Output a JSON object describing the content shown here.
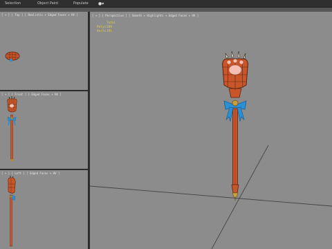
{
  "menubar": {
    "items": [
      "Selection",
      "Object Paint",
      "Populate"
    ],
    "icon": "dropdown-icon"
  },
  "viewports": {
    "top": {
      "label": "[ + ] [ Top ] [ Realistic + Edged Faces + HV ]"
    },
    "front": {
      "label": "[ + ] [ Front ] [ Edged Faces + HV ]"
    },
    "left": {
      "label": "[ + ] [ Left ] [ Edged Faces + HV ]"
    },
    "perspective": {
      "label": "[ + ] [ Perspective ] [ Smooth + Highlights + Edged Faces + HV ]",
      "stats": [
        {
          "label": "",
          "value": "Total"
        },
        {
          "label": "Polys",
          "value": "209"
        },
        {
          "label": "Verts",
          "value": "191"
        }
      ]
    }
  },
  "colors": {
    "viewport_bg": "#8c8c8c",
    "model_orange": "#c8562a",
    "ribbon_blue": "#2b8fd6",
    "gold": "#b28a2a",
    "stats_yellow": "#e6d14a"
  }
}
